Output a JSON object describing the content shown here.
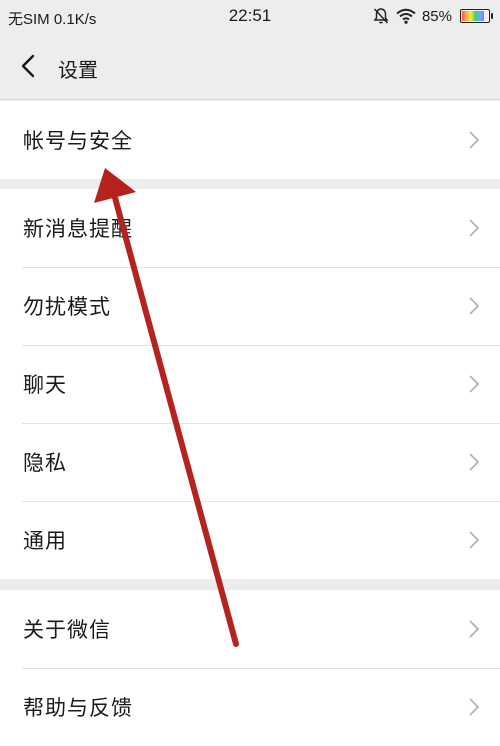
{
  "status_bar": {
    "carrier": "无SIM",
    "speed": "0.1K/s",
    "time": "22:51",
    "battery": "85%",
    "battery_level": 0.85,
    "icons": [
      "mute-bell-icon",
      "wifi-icon",
      "battery-icon"
    ]
  },
  "nav": {
    "title": "设置",
    "back_icon": "chevron-left-icon"
  },
  "groups": [
    {
      "items": [
        {
          "label": "帐号与安全"
        }
      ]
    },
    {
      "items": [
        {
          "label": "新消息提醒"
        },
        {
          "label": "勿扰模式"
        },
        {
          "label": "聊天"
        },
        {
          "label": "隐私"
        },
        {
          "label": "通用"
        }
      ]
    },
    {
      "items": [
        {
          "label": "关于微信"
        },
        {
          "label": "帮助与反馈"
        }
      ]
    }
  ],
  "colors": {
    "background": "#ececec",
    "row": "#ffffff",
    "arrow": "#b5231f"
  },
  "annotation": {
    "type": "arrow",
    "color": "#b5231f",
    "points_to": "帐号与安全"
  }
}
